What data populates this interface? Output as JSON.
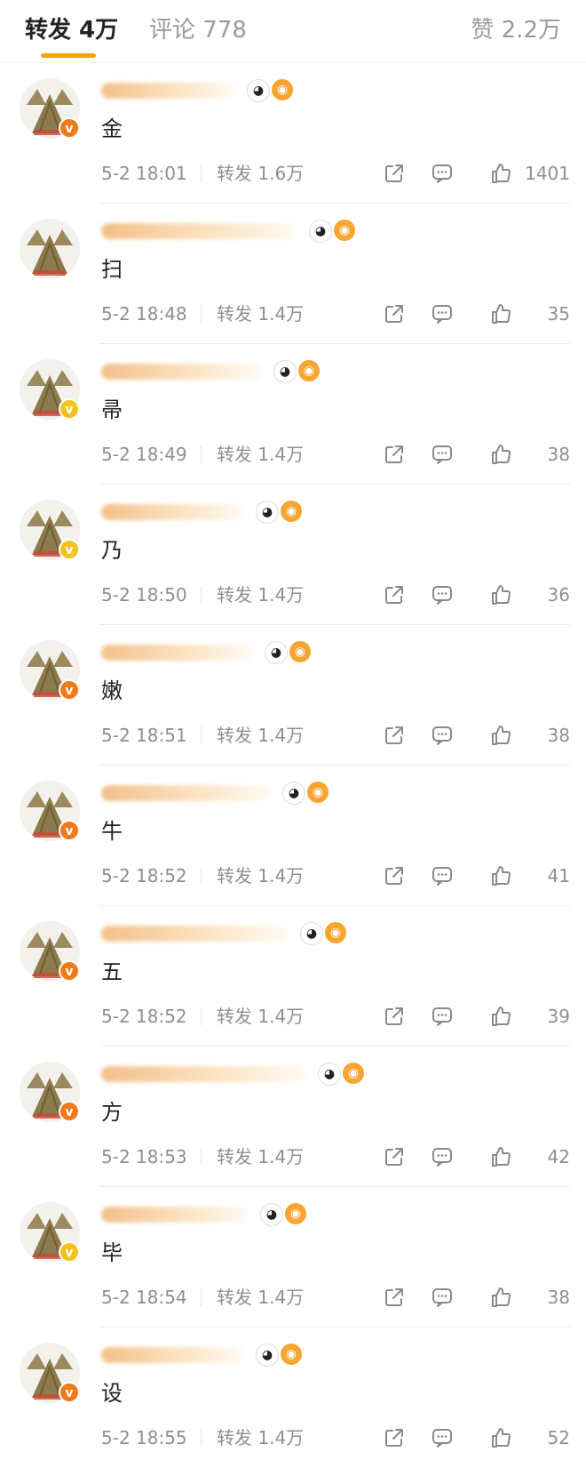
{
  "tabs": {
    "repost": "转发 4万",
    "comment": "评论 778",
    "likes": "赞 2.2万"
  },
  "colors": {
    "accent": "#f5a300",
    "badge_orange": "#f07a1a",
    "badge_yellow": "#f4c21d"
  },
  "comments": [
    {
      "content": "金",
      "time": "5-2 18:01",
      "reposts": "转发 1.6万",
      "likes": "1401",
      "badge": "orange"
    },
    {
      "content": "扫",
      "time": "5-2 18:48",
      "reposts": "转发 1.4万",
      "likes": "35",
      "badge": "none"
    },
    {
      "content": "帚",
      "time": "5-2 18:49",
      "reposts": "转发 1.4万",
      "likes": "38",
      "badge": "yellow"
    },
    {
      "content": "乃",
      "time": "5-2 18:50",
      "reposts": "转发 1.4万",
      "likes": "36",
      "badge": "yellow"
    },
    {
      "content": "嫩",
      "time": "5-2 18:51",
      "reposts": "转发 1.4万",
      "likes": "38",
      "badge": "orange"
    },
    {
      "content": "牛",
      "time": "5-2 18:52",
      "reposts": "转发 1.4万",
      "likes": "41",
      "badge": "orange"
    },
    {
      "content": "五",
      "time": "5-2 18:52",
      "reposts": "转发 1.4万",
      "likes": "39",
      "badge": "orange"
    },
    {
      "content": "方",
      "time": "5-2 18:53",
      "reposts": "转发 1.4万",
      "likes": "42",
      "badge": "orange"
    },
    {
      "content": "毕",
      "time": "5-2 18:54",
      "reposts": "转发 1.4万",
      "likes": "38",
      "badge": "yellow"
    },
    {
      "content": "设",
      "time": "5-2 18:55",
      "reposts": "转发 1.4万",
      "likes": "52",
      "badge": "orange"
    }
  ],
  "icons": {
    "share": "share-icon",
    "comment": "comment-icon",
    "like": "thumbs-up-icon",
    "verified": "verified-v-icon"
  }
}
